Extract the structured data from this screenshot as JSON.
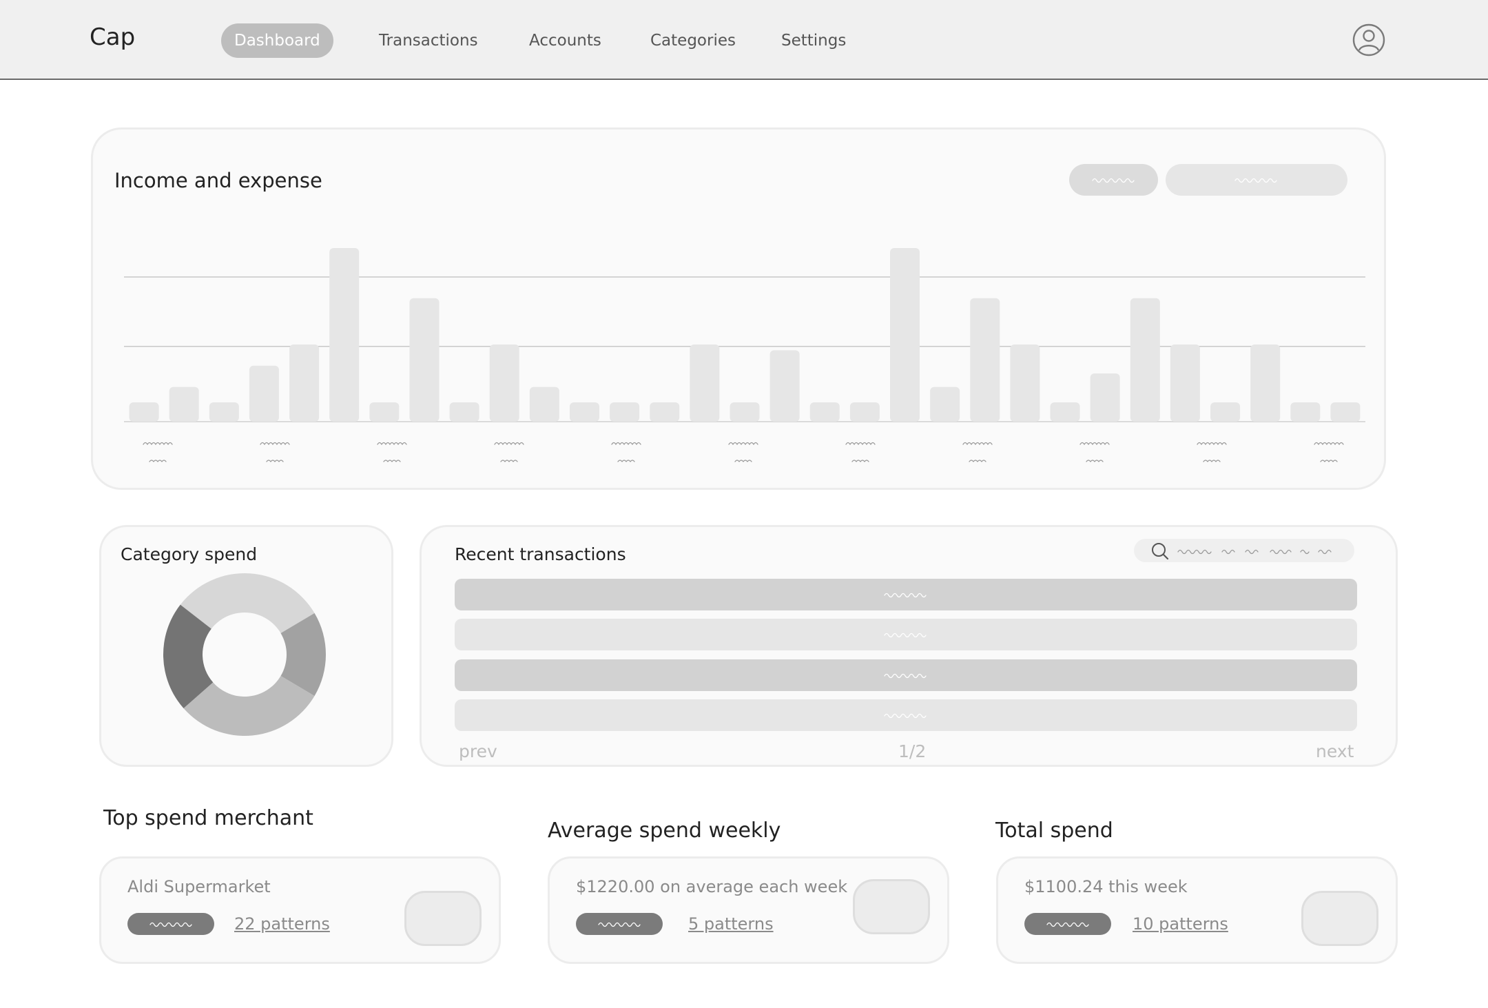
{
  "app": {
    "brand": "Cap"
  },
  "nav": {
    "items": [
      {
        "label": "Dashboard",
        "active": true
      },
      {
        "label": "Transactions",
        "active": false
      },
      {
        "label": "Accounts",
        "active": false
      },
      {
        "label": "Categories",
        "active": false
      },
      {
        "label": "Settings",
        "active": false
      }
    ],
    "avatar_icon": "user-circle-icon"
  },
  "income_expense": {
    "title": "Income and expense",
    "toggle_icon": "placeholder-text-squiggle"
  },
  "chart_data": {
    "type": "bar",
    "title": "Income and expense",
    "values": [
      1,
      1.8,
      1,
      2.9,
      4,
      9,
      1,
      6.4,
      1,
      4,
      1.8,
      1,
      1,
      1,
      4,
      1,
      3.7,
      1,
      1,
      9,
      1.8,
      6.4,
      4,
      1,
      2.5,
      6.4,
      4,
      1,
      4,
      1,
      1
    ],
    "ylim": [
      0,
      10
    ],
    "grid": true,
    "bar_color": "#e6e6e6",
    "grid_color": "#c8c8c8"
  },
  "category_spend": {
    "title": "Category spend",
    "slices": [
      {
        "value": 31,
        "color": "#d7d7d7"
      },
      {
        "value": 17,
        "color": "#a2a2a2"
      },
      {
        "value": 30,
        "color": "#bcbcbc"
      },
      {
        "value": 22,
        "color": "#747474"
      }
    ]
  },
  "recent_transactions": {
    "title": "Recent transactions",
    "search_icon": "search-icon",
    "pager": {
      "prev": "prev",
      "page": "1/2",
      "next": "next"
    }
  },
  "stats": [
    {
      "heading": "Top spend merchant",
      "text": "Aldi Supermarket",
      "link": "22 patterns"
    },
    {
      "heading": "Average spend weekly",
      "text": "$1220.00 on average each week",
      "link": "5 patterns"
    },
    {
      "heading": "Total spend",
      "text": "$1100.24 this week",
      "link": "10 patterns"
    }
  ]
}
